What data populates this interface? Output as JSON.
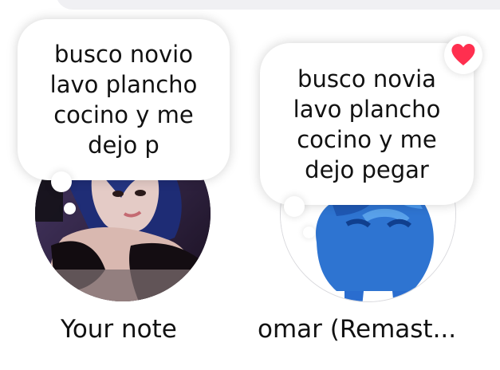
{
  "notes": {
    "left": {
      "bubble_text": "busco novio\nlavo plancho\ncocino y me\ndejo p",
      "name": "Your note"
    },
    "right": {
      "bubble_text": "busco novia\nlavo plancho\ncocino y me\ndejo pegar",
      "name": "omar (Remast...",
      "liked": true
    }
  },
  "colors": {
    "heart": "#ff2f4f",
    "text": "#111111",
    "search_bar": "#f0f0f3"
  },
  "icons": {
    "heart": "heart-icon"
  }
}
